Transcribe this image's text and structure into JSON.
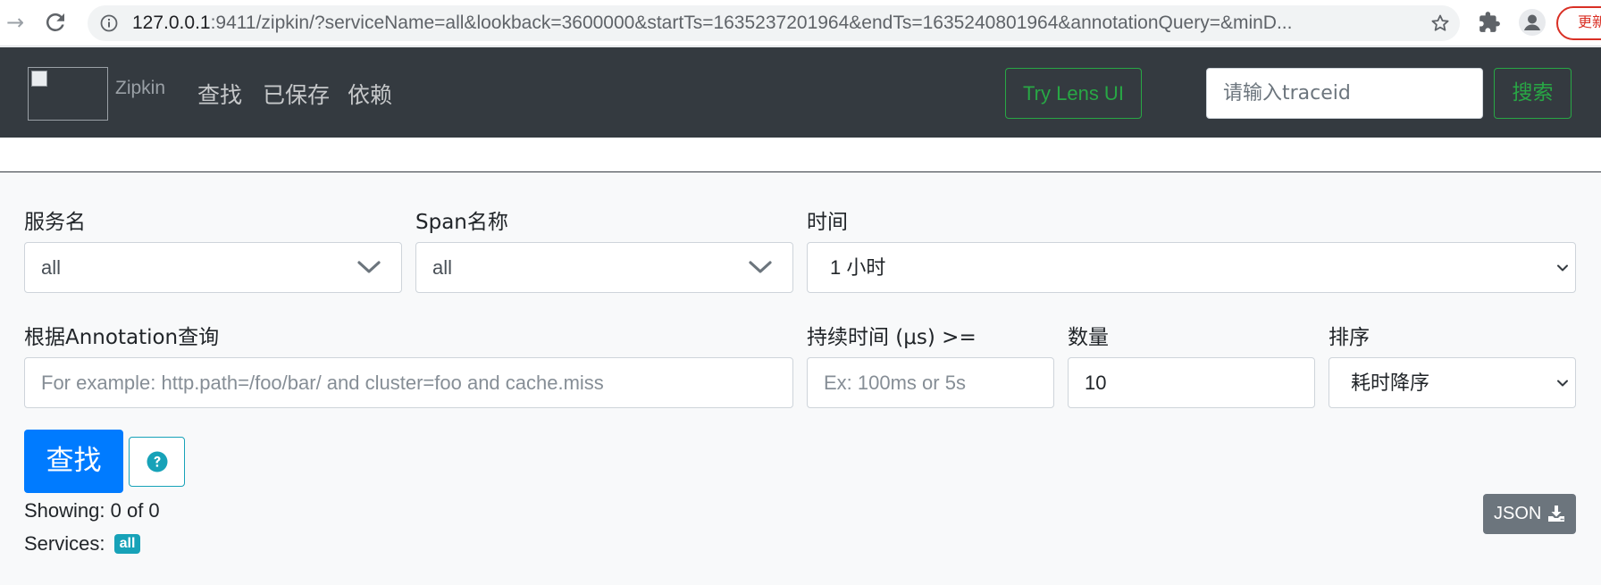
{
  "browser": {
    "url_host": "127.0.0.1",
    "url_rest": ":9411/zipkin/?serviceName=all&lookback=3600000&startTs=1635237201964&endTs=1635240801964&annotationQuery=&minD...",
    "update_label": "更新"
  },
  "navbar": {
    "brand": "Zipkin",
    "links": [
      "查找",
      "已保存",
      "依赖"
    ],
    "lens_button": "Try Lens UI",
    "traceid_placeholder": "请输入traceid",
    "search_button": "搜索"
  },
  "form": {
    "service": {
      "label": "服务名",
      "value": "all"
    },
    "span": {
      "label": "Span名称",
      "value": "all"
    },
    "time": {
      "label": "时间",
      "value": "1 小时"
    },
    "annotation": {
      "label": "根据Annotation查询",
      "placeholder": "For example: http.path=/foo/bar/ and cluster=foo and cache.miss"
    },
    "duration": {
      "label": "持续时间 (μs) >=",
      "placeholder": "Ex: 100ms or 5s"
    },
    "limit": {
      "label": "数量",
      "value": "10"
    },
    "sort": {
      "label": "排序",
      "value": "耗时降序"
    },
    "find_button": "查找"
  },
  "results": {
    "showing": "Showing: 0 of 0",
    "services_label": "Services:",
    "services_badge": "all",
    "json_button": "JSON"
  }
}
